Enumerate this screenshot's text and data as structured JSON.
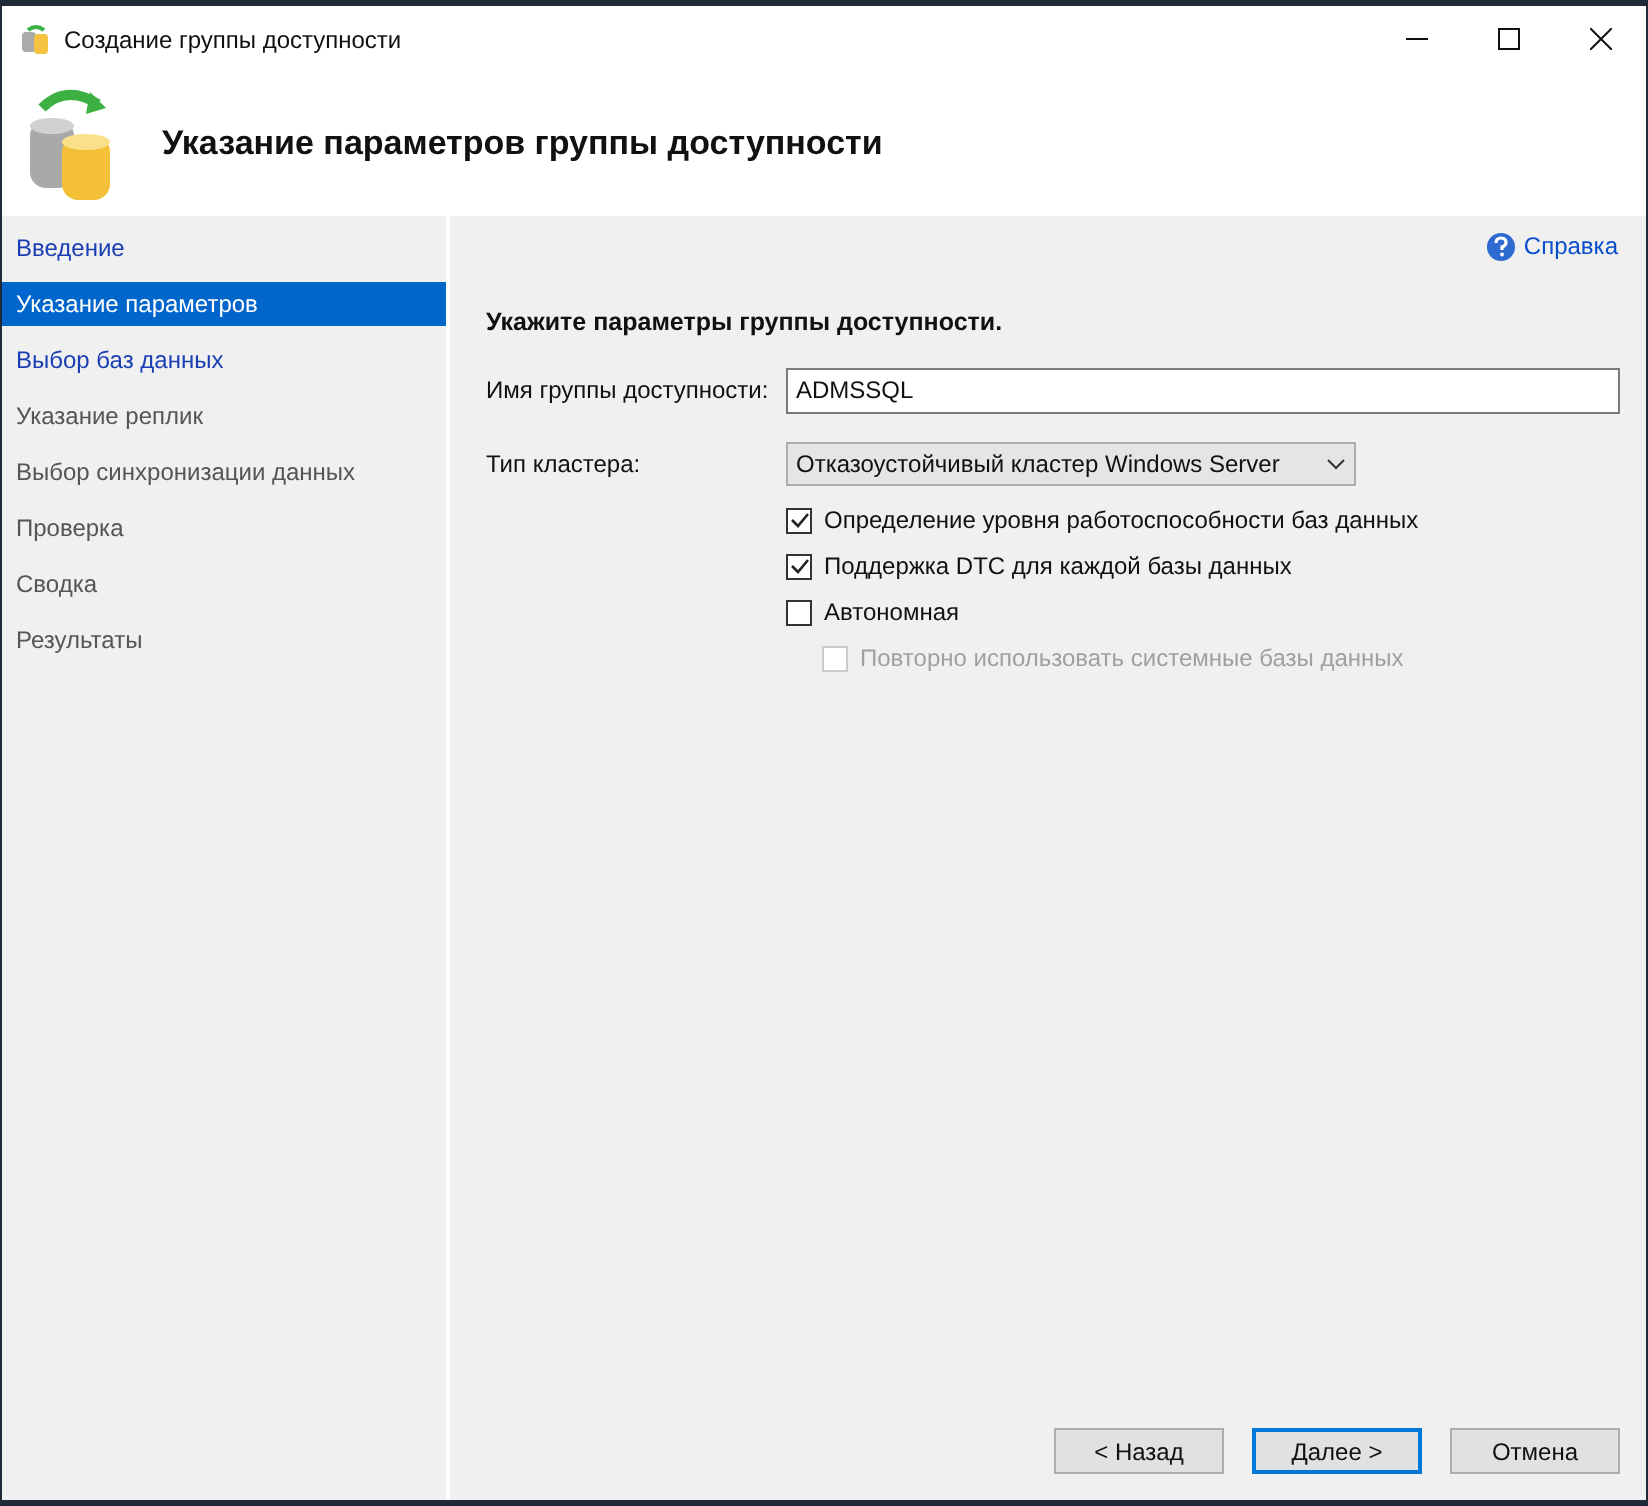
{
  "window": {
    "title": "Создание группы доступности"
  },
  "header": {
    "title": "Указание параметров группы доступности"
  },
  "sidebar": {
    "items": [
      {
        "label": "Введение",
        "selected": false,
        "enabled": true
      },
      {
        "label": "Указание параметров",
        "selected": true,
        "enabled": true
      },
      {
        "label": "Выбор баз данных",
        "selected": false,
        "enabled": true
      },
      {
        "label": "Указание реплик",
        "selected": false,
        "enabled": false
      },
      {
        "label": "Выбор синхронизации данных",
        "selected": false,
        "enabled": false
      },
      {
        "label": "Проверка",
        "selected": false,
        "enabled": false
      },
      {
        "label": "Сводка",
        "selected": false,
        "enabled": false
      },
      {
        "label": "Результаты",
        "selected": false,
        "enabled": false
      }
    ]
  },
  "help_link": "Справка",
  "content": {
    "heading": "Укажите параметры группы доступности.",
    "name_label": "Имя группы доступности:",
    "name_value": "ADMSSQL",
    "cluster_label": "Тип кластера:",
    "cluster_value": "Отказоустойчивый кластер Windows Server",
    "options": [
      {
        "label": "Определение уровня работоспособности баз данных",
        "checked": true,
        "disabled": false,
        "nested": false
      },
      {
        "label": "Поддержка DTC для каждой базы данных",
        "checked": true,
        "disabled": false,
        "nested": false
      },
      {
        "label": "Автономная",
        "checked": false,
        "disabled": false,
        "nested": false
      },
      {
        "label": "Повторно использовать системные базы данных",
        "checked": false,
        "disabled": true,
        "nested": true
      }
    ]
  },
  "buttons": [
    {
      "label": "< Назад",
      "default": false
    },
    {
      "label": "Далее >",
      "default": true
    },
    {
      "label": "Отмена",
      "default": false
    }
  ]
}
